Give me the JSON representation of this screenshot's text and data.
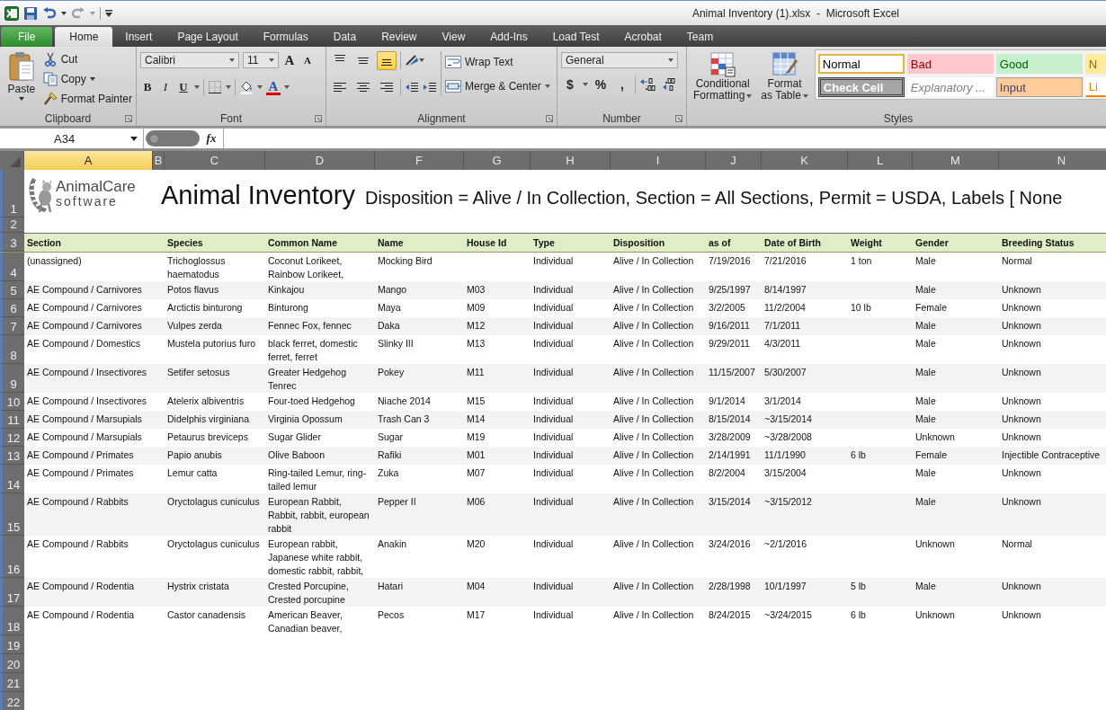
{
  "window": {
    "title": "Animal Inventory (1).xlsx  -  Microsoft Excel"
  },
  "ribbon_tabs": [
    {
      "label": "File",
      "kind": "file",
      "selected": false
    },
    {
      "label": "Home",
      "kind": "tab",
      "selected": true
    },
    {
      "label": "Insert",
      "kind": "tab",
      "selected": false
    },
    {
      "label": "Page Layout",
      "kind": "tab",
      "selected": false
    },
    {
      "label": "Formulas",
      "kind": "tab",
      "selected": false
    },
    {
      "label": "Data",
      "kind": "tab",
      "selected": false
    },
    {
      "label": "Review",
      "kind": "tab",
      "selected": false
    },
    {
      "label": "View",
      "kind": "tab",
      "selected": false
    },
    {
      "label": "Add-Ins",
      "kind": "tab",
      "selected": false
    },
    {
      "label": "Load Test",
      "kind": "tab",
      "selected": false
    },
    {
      "label": "Acrobat",
      "kind": "tab",
      "selected": false
    },
    {
      "label": "Team",
      "kind": "tab",
      "selected": false
    }
  ],
  "clipboard": {
    "label": "Clipboard",
    "paste": "Paste",
    "cut": "Cut",
    "copy": "Copy",
    "format_painter": "Format Painter"
  },
  "font": {
    "label": "Font",
    "family": "Calibri",
    "size": "11",
    "grow": "A",
    "shrink": "A",
    "bold": "B",
    "italic": "I",
    "underline": "U",
    "font_color": "A"
  },
  "alignment": {
    "label": "Alignment",
    "vertical": [
      {
        "kind": "top",
        "selected": false
      },
      {
        "kind": "middle",
        "selected": false
      },
      {
        "kind": "bottom",
        "selected": true
      }
    ],
    "horizontal": [
      {
        "kind": "left",
        "selected": false
      },
      {
        "kind": "center",
        "selected": false
      },
      {
        "kind": "right",
        "selected": false
      }
    ],
    "wrap_text": "Wrap Text",
    "merge": "Merge & Center"
  },
  "number": {
    "label": "Number",
    "format": "General",
    "currency": "$",
    "percent": "%",
    "comma": ","
  },
  "styles": {
    "label": "Styles",
    "conditional": [
      "Conditional",
      "Formatting"
    ],
    "format_table": [
      "Format",
      "as Table"
    ],
    "cell_styles": [
      {
        "label": "Normal",
        "kind": "normal",
        "selected": true
      },
      {
        "label": "Bad",
        "kind": "bad",
        "selected": false
      },
      {
        "label": "Good",
        "kind": "good",
        "selected": false
      },
      {
        "label": "N",
        "kind": "neutral",
        "selected": false
      },
      {
        "label": "Check Cell",
        "kind": "check",
        "selected": false
      },
      {
        "label": "Explanatory ...",
        "kind": "explanatory",
        "selected": false
      },
      {
        "label": "Input",
        "kind": "input",
        "selected": false
      },
      {
        "label": "Li",
        "kind": "linked",
        "selected": false
      }
    ]
  },
  "formula_bar": {
    "name_box": "A34",
    "function_label": "fx"
  },
  "sheet": {
    "columns": [
      {
        "label": "A",
        "selected": true
      },
      {
        "label": "B",
        "selected": false
      },
      {
        "label": "C",
        "selected": false
      },
      {
        "label": "D",
        "selected": false
      },
      {
        "label": "F",
        "selected": false
      },
      {
        "label": "G",
        "selected": false
      },
      {
        "label": "H",
        "selected": false
      },
      {
        "label": "I",
        "selected": false
      },
      {
        "label": "J",
        "selected": false
      },
      {
        "label": "K",
        "selected": false
      },
      {
        "label": "L",
        "selected": false
      },
      {
        "label": "M",
        "selected": false
      },
      {
        "label": "N",
        "selected": false
      }
    ],
    "row_numbers": [
      "1",
      "2",
      "3",
      "4",
      "5",
      "6",
      "7",
      "8",
      "9",
      "10",
      "11",
      "12",
      "13",
      "14",
      "15",
      "16",
      "17",
      "18",
      "19",
      "20",
      "21",
      "22"
    ],
    "logo": {
      "word": "AnimalCare",
      "tagline": "software"
    },
    "title": "Animal Inventory",
    "subtitle": "Disposition = Alive / In Collection, Section = All Sections, Permit = USDA, Labels [ None",
    "headers": [
      "Section",
      "Species",
      "Common Name",
      "Name",
      "House Id",
      "Type",
      "Disposition",
      "as of",
      "Date of Birth",
      "Weight",
      "Gender",
      "Breeding Status"
    ],
    "rows": [
      {
        "section": "(unassigned)",
        "species": "Trichoglossus haematodus",
        "common_name": "Coconut Lorikeet, Rainbow Lorikeet,",
        "name": "Mocking Bird",
        "type": "Individual",
        "disposition": "Alive / In Collection",
        "as_of": "7/19/2016",
        "date_of_birth": "7/21/2016",
        "weight": "1 ton",
        "gender": "Male",
        "breeding_status": "Normal"
      },
      {
        "section": "AE Compound / Carnivores",
        "species": "Potos flavus",
        "common_name": "Kinkajou",
        "name": "Mango",
        "house_id": "M03",
        "type": "Individual",
        "disposition": "Alive / In Collection",
        "as_of": "9/25/1997",
        "date_of_birth": "8/14/1997",
        "gender": "Male",
        "breeding_status": "Unknown"
      },
      {
        "section": "AE Compound / Carnivores",
        "species": "Arctictis binturong",
        "common_name": "Binturong",
        "name": "Maya",
        "house_id": "M09",
        "type": "Individual",
        "disposition": "Alive / In Collection",
        "as_of": "3/2/2005",
        "date_of_birth": "11/2/2004",
        "weight": "10 lb",
        "gender": "Female",
        "breeding_status": "Unknown"
      },
      {
        "section": "AE Compound / Carnivores",
        "species": "Vulpes zerda",
        "common_name": "Fennec Fox, fennec",
        "name": "Daka",
        "house_id": "M12",
        "type": "Individual",
        "disposition": "Alive / In Collection",
        "as_of": "9/16/2011",
        "date_of_birth": "7/1/2011",
        "gender": "Male",
        "breeding_status": "Unknown"
      },
      {
        "section": "AE Compound / Domestics",
        "species": "Mustela putorius furo",
        "common_name": "black ferret, domestic ferret, ferret",
        "name": "Slinky III",
        "house_id": "M13",
        "type": "Individual",
        "disposition": "Alive / In Collection",
        "as_of": "9/29/2011",
        "date_of_birth": "4/3/2011",
        "gender": "Male",
        "breeding_status": "Unknown"
      },
      {
        "section": "AE Compound / Insectivores",
        "species": "Setifer setosus",
        "common_name": "Greater Hedgehog Tenrec",
        "name": "Pokey",
        "house_id": "M11",
        "type": "Individual",
        "disposition": "Alive / In Collection",
        "as_of": "11/15/2007",
        "date_of_birth": "5/30/2007",
        "gender": "Male",
        "breeding_status": "Unknown"
      },
      {
        "section": "AE Compound / Insectivores",
        "species": "Atelerix albiventris",
        "common_name": "Four-toed Hedgehog",
        "name": "Niache 2014",
        "house_id": "M15",
        "type": "Individual",
        "disposition": "Alive / In Collection",
        "as_of": "9/1/2014",
        "date_of_birth": "3/1/2014",
        "gender": "Male",
        "breeding_status": "Unknown"
      },
      {
        "section": "AE Compound / Marsupials",
        "species": "Didelphis virginiana",
        "common_name": "Virginia Opossum",
        "name": "Trash Can 3",
        "house_id": "M14",
        "type": "Individual",
        "disposition": "Alive / In Collection",
        "as_of": "8/15/2014",
        "date_of_birth": "~3/15/2014",
        "gender": "Male",
        "breeding_status": "Unknown"
      },
      {
        "section": "AE Compound / Marsupials",
        "species": "Petaurus breviceps",
        "common_name": "Sugar Glider",
        "name": "Sugar",
        "house_id": "M19",
        "type": "Individual",
        "disposition": "Alive / In Collection",
        "as_of": "3/28/2009",
        "date_of_birth": "~3/28/2008",
        "gender": "Unknown",
        "breeding_status": "Unknown"
      },
      {
        "section": "AE Compound / Primates",
        "species": "Papio anubis",
        "common_name": "Olive Baboon",
        "name": "Rafiki",
        "house_id": "M01",
        "type": "Individual",
        "disposition": "Alive / In Collection",
        "as_of": "2/14/1991",
        "date_of_birth": "11/1/1990",
        "weight": "6 lb",
        "gender": "Female",
        "breeding_status": "Injectible Contraceptive"
      },
      {
        "section": "AE Compound / Primates",
        "species": "Lemur catta",
        "common_name": "Ring-tailed Lemur, ring-tailed lemur",
        "name": "Zuka",
        "house_id": "M07",
        "type": "Individual",
        "disposition": "Alive / In Collection",
        "as_of": "8/2/2004",
        "date_of_birth": "3/15/2004",
        "gender": "Male",
        "breeding_status": "Unknown"
      },
      {
        "section": "AE Compound / Rabbits",
        "species": "Oryctolagus cuniculus",
        "common_name": "European Rabbit, Rabbit, rabbit, european rabbit",
        "name": "Pepper II",
        "house_id": "M06",
        "type": "Individual",
        "disposition": "Alive / In Collection",
        "as_of": "3/15/2014",
        "date_of_birth": "~3/15/2012",
        "gender": "Male",
        "breeding_status": "Unknown"
      },
      {
        "section": "AE Compound / Rabbits",
        "species": "Oryctolagus cuniculus",
        "common_name": "European rabbit, Japanese white rabbit, domestic rabbit, rabbit,",
        "name": "Anakin",
        "house_id": "M20",
        "type": "Individual",
        "disposition": "Alive / In Collection",
        "as_of": "3/24/2016",
        "date_of_birth": "~2/1/2016",
        "gender": "Unknown",
        "breeding_status": "Normal"
      },
      {
        "section": "AE Compound / Rodentia",
        "species": "Hystrix cristata",
        "common_name": "Crested Porcupine, Crested porcupine",
        "name": "Hatari",
        "house_id": "M04",
        "type": "Individual",
        "disposition": "Alive / In Collection",
        "as_of": "2/28/1998",
        "date_of_birth": "10/1/1997",
        "weight": "5 lb",
        "gender": "Male",
        "breeding_status": "Unknown"
      },
      {
        "section": "AE Compound / Rodentia",
        "species": "Castor canadensis",
        "common_name": "American Beaver, Canadian beaver,",
        "name": "Pecos",
        "house_id": "M17",
        "type": "Individual",
        "disposition": "Alive / In Collection",
        "as_of": "8/24/2015",
        "date_of_birth": "~3/24/2015",
        "weight": "6 lb",
        "gender": "Unknown",
        "breeding_status": "Unknown"
      }
    ]
  }
}
